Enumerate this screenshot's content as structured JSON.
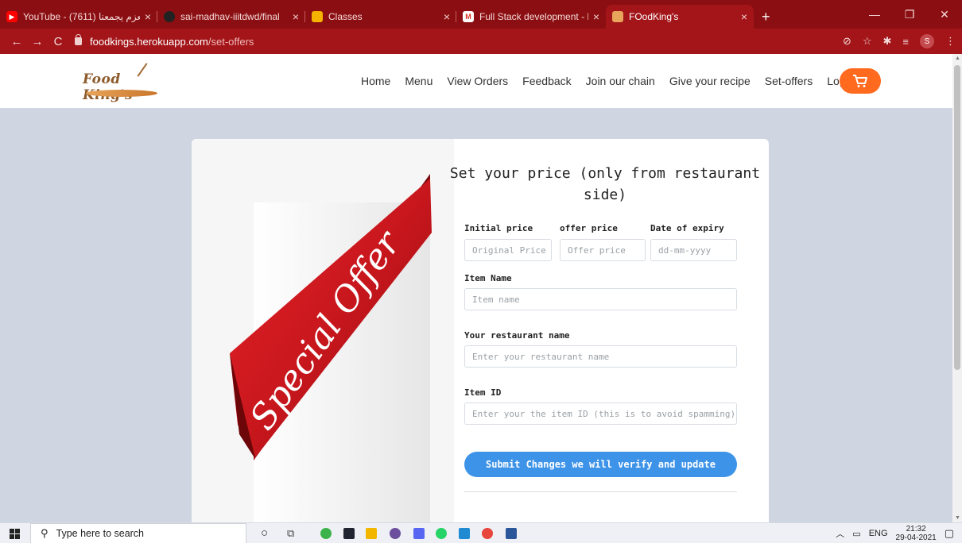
{
  "browser": {
    "tabs": [
      {
        "label": "YouTube - العزم يجمعنا (7611)"
      },
      {
        "label": "sai-madhav-iiitdwd/final"
      },
      {
        "label": "Classes"
      },
      {
        "label": "Full Stack development - Project"
      },
      {
        "label": "FOodKing's"
      }
    ],
    "new_tab": "+",
    "url_host": "foodkings.herokuapp.com",
    "url_path": "/set-offers",
    "profile_initial": "S"
  },
  "site": {
    "logo_text": "Food King's",
    "nav": [
      "Home",
      "Menu",
      "View Orders",
      "Feedback",
      "Join our chain",
      "Give your recipe",
      "Set-offers",
      "Logout"
    ]
  },
  "offer_banner": {
    "text": "Special Offer"
  },
  "form": {
    "title_line1": "Set your price (only from restaurant",
    "title_line2": "side)",
    "initial_price_label": "Initial price",
    "initial_price_placeholder": "Original Price",
    "offer_price_label": "offer price",
    "offer_price_placeholder": "Offer price",
    "expiry_label": "Date of expiry",
    "expiry_placeholder": "dd-mm-yyyy",
    "item_name_label": "Item Name",
    "item_name_placeholder": "Item name",
    "restaurant_label": "Your restaurant name",
    "restaurant_placeholder": "Enter your restaurant name",
    "item_id_label": "Item ID",
    "item_id_placeholder": "Enter your the item ID (this is to avoid spamming)",
    "submit_label": "Submit Changes we will verify and update"
  },
  "taskbar": {
    "search_placeholder": "Type here to search",
    "lang": "ENG",
    "time": "21:32",
    "date": "29-04-2021"
  },
  "colors": {
    "browser_frame": "#8b0f12",
    "page_bg": "#cfd6e1",
    "cart_orange": "#ff6a1f",
    "submit_blue": "#3d93e8",
    "ribbon_red": "#c8171d"
  }
}
